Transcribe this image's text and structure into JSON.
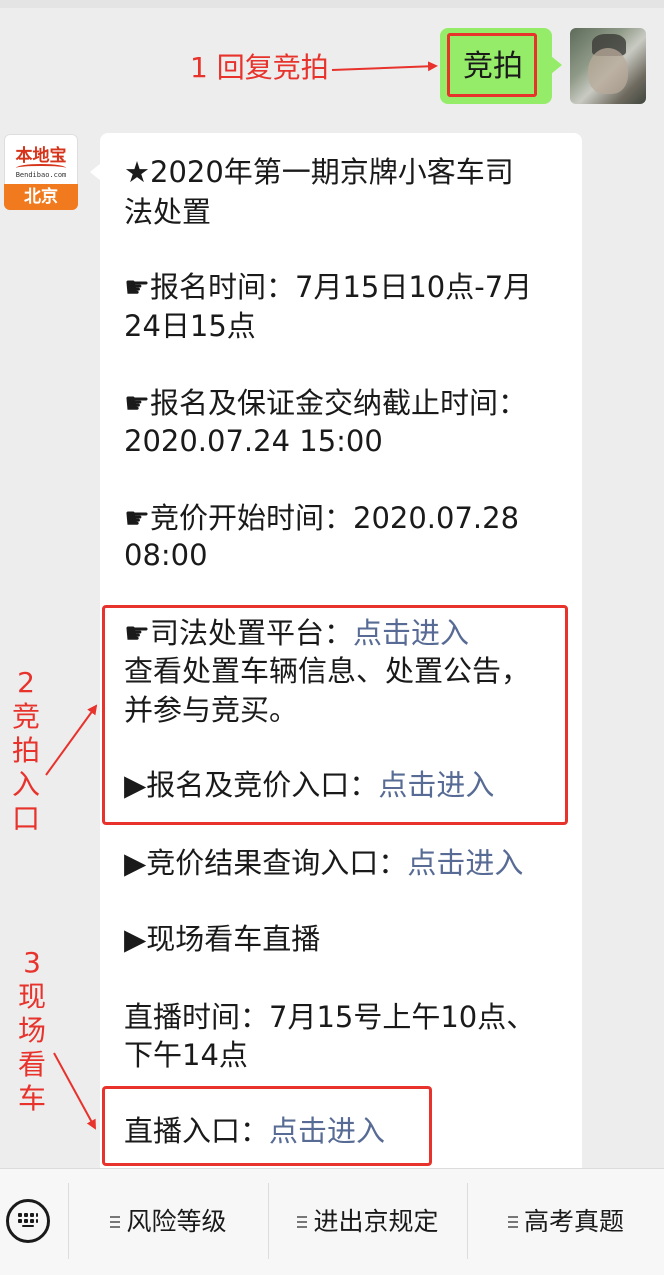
{
  "user_message": {
    "text": "竞拍"
  },
  "annotations": {
    "step1": "1 回复竞拍",
    "step2": "2\n竞\n拍\n入\n口",
    "step3": "3\n现\n场\n看\n车"
  },
  "bot": {
    "avatar": {
      "brand": "本地宝",
      "site": "Bendibao.com",
      "city": "北京"
    },
    "lines": {
      "title_1": "★2020年第一期京牌小客车司",
      "title_2": "法处置",
      "signup_time_1": "☛报名时间：7月15日10点-7月",
      "signup_time_2": "24日15点",
      "deposit_deadline_1": "☛报名及保证金交纳截止时间：",
      "deposit_deadline_2": "2020.07.24 15:00",
      "bid_start_1": "☛竞价开始时间：2020.07.28",
      "bid_start_2": "08:00",
      "platform_label": "☛司法处置平台：",
      "platform_link": "点击进入",
      "platform_desc_1": "查看处置车辆信息、处置公告，",
      "platform_desc_2": "并参与竞买。",
      "bid_entry_label": "▶报名及竞价入口：",
      "bid_entry_link": "点击进入",
      "result_label": "▶竞价结果查询入口：",
      "result_link": "点击进入",
      "live_title": "▶现场看车直播",
      "live_time_1": "直播时间：7月15号上午10点、",
      "live_time_2": "下午14点",
      "live_entry_label": "直播入口：",
      "live_entry_link": "点击进入"
    }
  },
  "bottom_menu": {
    "items": [
      {
        "label": "风险等级"
      },
      {
        "label": "进出京规定"
      },
      {
        "label": "高考真题"
      }
    ]
  },
  "colors": {
    "background": "#ededed",
    "user_bubble": "#95ec69",
    "bot_bubble": "#ffffff",
    "link": "#576b95",
    "annotation_red": "#e8322c"
  },
  "icons": {
    "keyboard": "keyboard-icon",
    "menu": "menu-lines-icon"
  }
}
